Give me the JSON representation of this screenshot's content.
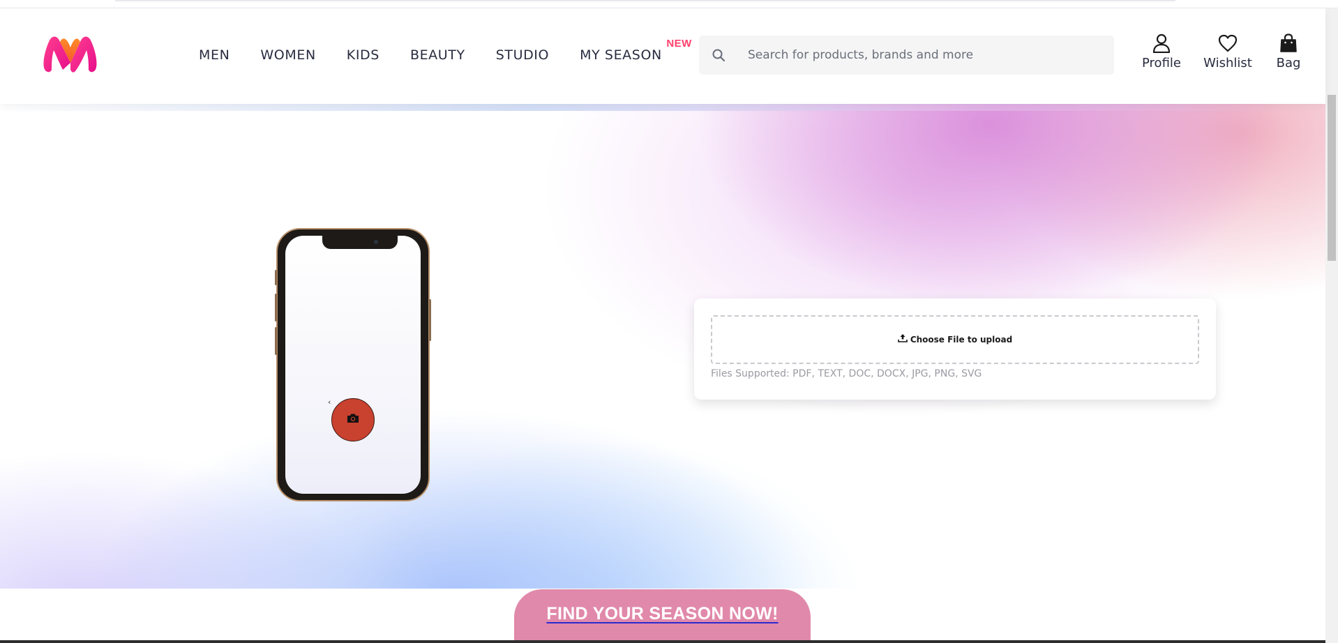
{
  "header": {
    "logo_icon": "myntra-logo",
    "nav": [
      {
        "label": "MEN"
      },
      {
        "label": "WOMEN"
      },
      {
        "label": "KIDS"
      },
      {
        "label": "BEAUTY"
      },
      {
        "label": "STUDIO"
      },
      {
        "label": "MY SEASON",
        "badge": "NEW"
      }
    ],
    "search": {
      "placeholder": "Search for products, brands and more",
      "value": "",
      "icon": "search-icon"
    },
    "actions": [
      {
        "label": "Profile",
        "icon": "profile-icon"
      },
      {
        "label": "Wishlist",
        "icon": "heart-icon"
      },
      {
        "label": "Bag",
        "icon": "bag-icon"
      }
    ]
  },
  "hero": {
    "phone": {
      "back_glyph": "‹",
      "capture_icon": "camera-icon",
      "capture_color": "#c9412f"
    },
    "upload": {
      "button_label": "Choose File to upload",
      "icon": "upload-icon",
      "note": "Files Supported: PDF, TEXT, DOC, DOCX, JPG, PNG, SVG"
    }
  },
  "cta": {
    "label": "FIND YOUR SEASON NOW!",
    "color": "#e189aa"
  },
  "colors": {
    "accent": "#ff3f6c",
    "text": "#282c3f",
    "search_bg": "#f5f5f6"
  }
}
